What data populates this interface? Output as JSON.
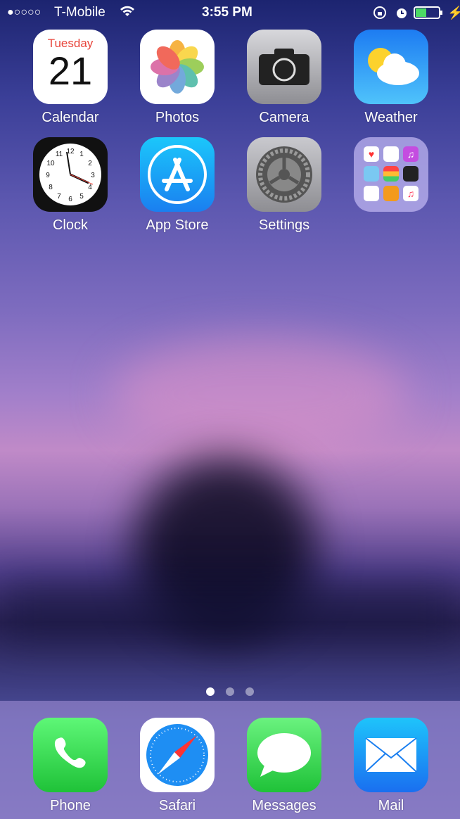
{
  "status": {
    "signal": "●○○○○",
    "carrier": "T-Mobile",
    "time": "3:55 PM",
    "battery_percent": 45,
    "icons": [
      "wifi-icon",
      "rotation-lock-icon",
      "alarm-icon",
      "battery-icon",
      "charging-icon"
    ]
  },
  "home": {
    "apps": [
      {
        "label": "Calendar",
        "day": "Tuesday",
        "date": "21"
      },
      {
        "label": "Photos"
      },
      {
        "label": "Camera"
      },
      {
        "label": "Weather"
      },
      {
        "label": "Clock"
      },
      {
        "label": "App Store"
      },
      {
        "label": "Settings"
      },
      {
        "label": "",
        "type": "folder"
      }
    ]
  },
  "page_indicator": {
    "pages": 3,
    "current": 1
  },
  "dock": {
    "apps": [
      {
        "label": "Phone"
      },
      {
        "label": "Safari"
      },
      {
        "label": "Messages"
      },
      {
        "label": "Mail"
      }
    ]
  },
  "colors": {
    "calendar_red": "#e8443a",
    "app_store_blue": "#1a8cf0",
    "messages_green": "#4cd964",
    "battery_green": "#4cd964"
  }
}
